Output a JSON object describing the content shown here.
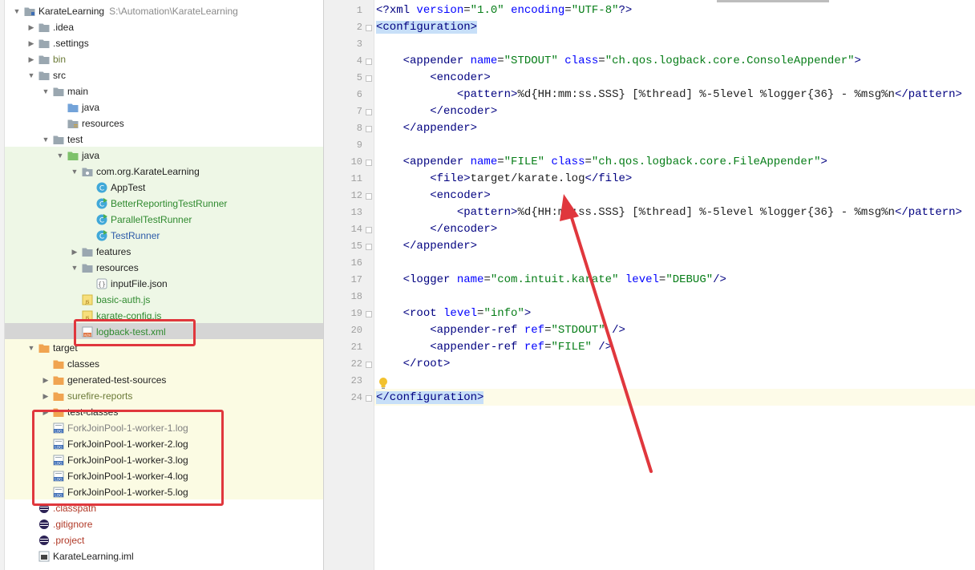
{
  "tree": {
    "rows": [
      {
        "level": 0,
        "expanded": true,
        "hasArrow": true,
        "icon": "module-folder",
        "label": "KarateLearning",
        "path": "S:\\Automation\\KarateLearning",
        "color": "default",
        "bold": true
      },
      {
        "level": 1,
        "expanded": false,
        "hasArrow": true,
        "icon": "folder",
        "label": ".idea",
        "color": "default"
      },
      {
        "level": 1,
        "expanded": false,
        "hasArrow": true,
        "icon": "folder",
        "label": ".settings",
        "color": "default"
      },
      {
        "level": 1,
        "expanded": false,
        "hasArrow": true,
        "icon": "folder",
        "label": "bin",
        "color": "olive"
      },
      {
        "level": 1,
        "expanded": true,
        "hasArrow": true,
        "icon": "folder",
        "label": "src",
        "color": "default"
      },
      {
        "level": 2,
        "expanded": true,
        "hasArrow": true,
        "icon": "folder",
        "label": "main",
        "color": "default"
      },
      {
        "level": 3,
        "expanded": false,
        "hasArrow": false,
        "icon": "source-folder",
        "label": "java",
        "color": "default"
      },
      {
        "level": 3,
        "expanded": false,
        "hasArrow": false,
        "icon": "resource-folder",
        "label": "resources",
        "color": "default"
      },
      {
        "level": 2,
        "expanded": true,
        "hasArrow": true,
        "icon": "folder",
        "label": "test",
        "color": "default"
      },
      {
        "level": 3,
        "expanded": true,
        "hasArrow": true,
        "icon": "test-folder",
        "label": "java",
        "color": "default"
      },
      {
        "level": 4,
        "expanded": true,
        "hasArrow": true,
        "icon": "package",
        "label": "com.org.KarateLearning",
        "color": "default"
      },
      {
        "level": 5,
        "expanded": false,
        "hasArrow": false,
        "icon": "class",
        "label": "AppTest",
        "color": "default"
      },
      {
        "level": 5,
        "expanded": false,
        "hasArrow": false,
        "icon": "class-run",
        "label": "BetterReportingTestRunner",
        "color": "green"
      },
      {
        "level": 5,
        "expanded": false,
        "hasArrow": false,
        "icon": "class-run",
        "label": "ParallelTestRunner",
        "color": "green"
      },
      {
        "level": 5,
        "expanded": false,
        "hasArrow": false,
        "icon": "class-run",
        "label": "TestRunner",
        "color": "blue"
      },
      {
        "level": 4,
        "expanded": false,
        "hasArrow": true,
        "icon": "folder",
        "label": "features",
        "color": "default"
      },
      {
        "level": 4,
        "expanded": true,
        "hasArrow": true,
        "icon": "folder",
        "label": "resources",
        "color": "default"
      },
      {
        "level": 5,
        "expanded": false,
        "hasArrow": false,
        "icon": "json",
        "label": "inputFile.json",
        "color": "default"
      },
      {
        "level": 4,
        "expanded": false,
        "hasArrow": false,
        "icon": "js",
        "label": "basic-auth.js",
        "color": "green"
      },
      {
        "level": 4,
        "expanded": false,
        "hasArrow": false,
        "icon": "js",
        "label": "karate-config.js",
        "color": "green"
      },
      {
        "level": 4,
        "expanded": false,
        "hasArrow": false,
        "icon": "xml",
        "label": "logback-test.xml",
        "color": "green",
        "selected": true
      },
      {
        "level": 1,
        "expanded": true,
        "hasArrow": true,
        "icon": "excluded-folder",
        "label": "target",
        "color": "default"
      },
      {
        "level": 2,
        "expanded": false,
        "hasArrow": false,
        "icon": "excluded-folder",
        "label": "classes",
        "color": "default"
      },
      {
        "level": 2,
        "expanded": false,
        "hasArrow": true,
        "icon": "excluded-folder",
        "label": "generated-test-sources",
        "color": "default"
      },
      {
        "level": 2,
        "expanded": false,
        "hasArrow": true,
        "icon": "excluded-folder",
        "label": "surefire-reports",
        "color": "olive"
      },
      {
        "level": 2,
        "expanded": false,
        "hasArrow": true,
        "icon": "excluded-folder",
        "label": "test-classes",
        "color": "default"
      },
      {
        "level": 2,
        "expanded": false,
        "hasArrow": false,
        "icon": "log",
        "label": "ForkJoinPool-1-worker-1.log",
        "color": "gray"
      },
      {
        "level": 2,
        "expanded": false,
        "hasArrow": false,
        "icon": "log",
        "label": "ForkJoinPool-1-worker-2.log",
        "color": "default"
      },
      {
        "level": 2,
        "expanded": false,
        "hasArrow": false,
        "icon": "log",
        "label": "ForkJoinPool-1-worker-3.log",
        "color": "default"
      },
      {
        "level": 2,
        "expanded": false,
        "hasArrow": false,
        "icon": "log",
        "label": "ForkJoinPool-1-worker-4.log",
        "color": "default"
      },
      {
        "level": 2,
        "expanded": false,
        "hasArrow": false,
        "icon": "log",
        "label": "ForkJoinPool-1-worker-5.log",
        "color": "default"
      },
      {
        "level": 1,
        "expanded": false,
        "hasArrow": false,
        "icon": "eclipse",
        "label": ".classpath",
        "color": "red"
      },
      {
        "level": 1,
        "expanded": false,
        "hasArrow": false,
        "icon": "eclipse",
        "label": ".gitignore",
        "color": "red"
      },
      {
        "level": 1,
        "expanded": false,
        "hasArrow": false,
        "icon": "eclipse",
        "label": ".project",
        "color": "red"
      },
      {
        "level": 1,
        "expanded": false,
        "hasArrow": false,
        "icon": "iml",
        "label": "KarateLearning.iml",
        "color": "default"
      }
    ]
  },
  "editor": {
    "lines": [
      [
        [
          "pi",
          "<?"
        ],
        [
          "tg",
          "xml "
        ],
        [
          "at",
          "version"
        ],
        [
          "tx",
          "="
        ],
        [
          "vl",
          "\"1.0\""
        ],
        [
          "tx",
          " "
        ],
        [
          "at",
          "encoding"
        ],
        [
          "tx",
          "="
        ],
        [
          "vl",
          "\"UTF-8\""
        ],
        [
          "pi",
          "?>"
        ]
      ],
      [
        [
          "tg",
          "<configuration>",
          "hl"
        ]
      ],
      [],
      [
        [
          "tx",
          "    "
        ],
        [
          "tg",
          "<appender "
        ],
        [
          "at",
          "name"
        ],
        [
          "tx",
          "="
        ],
        [
          "vl",
          "\"STDOUT\""
        ],
        [
          "tx",
          " "
        ],
        [
          "at",
          "class"
        ],
        [
          "tx",
          "="
        ],
        [
          "vl",
          "\"ch.qos.logback.core.ConsoleAppender\""
        ],
        [
          "tg",
          ">"
        ]
      ],
      [
        [
          "tx",
          "        "
        ],
        [
          "tg",
          "<encoder>"
        ]
      ],
      [
        [
          "tx",
          "            "
        ],
        [
          "tg",
          "<pattern>"
        ],
        [
          "tx",
          "%d{HH:mm:ss.SSS} [%thread] %-5level %logger{36} - %msg%n"
        ],
        [
          "tg",
          "</pattern>"
        ]
      ],
      [
        [
          "tx",
          "        "
        ],
        [
          "tg",
          "</encoder>"
        ]
      ],
      [
        [
          "tx",
          "    "
        ],
        [
          "tg",
          "</appender>"
        ]
      ],
      [],
      [
        [
          "tx",
          "    "
        ],
        [
          "tg",
          "<appender "
        ],
        [
          "at",
          "name"
        ],
        [
          "tx",
          "="
        ],
        [
          "vl",
          "\"FILE\""
        ],
        [
          "tx",
          " "
        ],
        [
          "at",
          "class"
        ],
        [
          "tx",
          "="
        ],
        [
          "vl",
          "\"ch.qos.logback.core.FileAppender\""
        ],
        [
          "tg",
          ">"
        ]
      ],
      [
        [
          "tx",
          "        "
        ],
        [
          "tg",
          "<file>"
        ],
        [
          "tx",
          "target/karate.log"
        ],
        [
          "tg",
          "</file>"
        ]
      ],
      [
        [
          "tx",
          "        "
        ],
        [
          "tg",
          "<encoder>"
        ]
      ],
      [
        [
          "tx",
          "            "
        ],
        [
          "tg",
          "<pattern>"
        ],
        [
          "tx",
          "%d{HH:mm:ss.SSS} [%thread] %-5level %logger{36} - %msg%n"
        ],
        [
          "tg",
          "</pattern>"
        ]
      ],
      [
        [
          "tx",
          "        "
        ],
        [
          "tg",
          "</encoder>"
        ]
      ],
      [
        [
          "tx",
          "    "
        ],
        [
          "tg",
          "</appender>"
        ]
      ],
      [],
      [
        [
          "tx",
          "    "
        ],
        [
          "tg",
          "<logger "
        ],
        [
          "at",
          "name"
        ],
        [
          "tx",
          "="
        ],
        [
          "vl",
          "\"com.intuit.karate\""
        ],
        [
          "tx",
          " "
        ],
        [
          "at",
          "level"
        ],
        [
          "tx",
          "="
        ],
        [
          "vl",
          "\"DEBUG\""
        ],
        [
          "tg",
          "/>"
        ]
      ],
      [],
      [
        [
          "tx",
          "    "
        ],
        [
          "tg",
          "<root "
        ],
        [
          "at",
          "level"
        ],
        [
          "tx",
          "="
        ],
        [
          "vl",
          "\"info\""
        ],
        [
          "tg",
          ">"
        ]
      ],
      [
        [
          "tx",
          "        "
        ],
        [
          "tg",
          "<appender-ref "
        ],
        [
          "at",
          "ref"
        ],
        [
          "tx",
          "="
        ],
        [
          "vl",
          "\"STDOUT\""
        ],
        [
          "tx",
          " "
        ],
        [
          "tg",
          "/>"
        ]
      ],
      [
        [
          "tx",
          "        "
        ],
        [
          "tg",
          "<appender-ref "
        ],
        [
          "at",
          "ref"
        ],
        [
          "tx",
          "="
        ],
        [
          "vl",
          "\"FILE\""
        ],
        [
          "tx",
          " "
        ],
        [
          "tg",
          "/>"
        ]
      ],
      [
        [
          "tx",
          "    "
        ],
        [
          "tg",
          "</root>"
        ]
      ],
      [],
      [
        [
          "tg",
          "</configuration>",
          "hl"
        ]
      ]
    ],
    "folds": [
      2,
      4,
      5,
      7,
      8,
      10,
      12,
      14,
      15,
      19,
      22,
      24
    ],
    "colors": {
      "tag": "#000080",
      "attribute": "#0000ff",
      "value": "#067d17",
      "text": "#1f1f1f",
      "bracket_highlight": "#c7dff8"
    }
  },
  "annotations": {
    "color": "#e0373d"
  }
}
